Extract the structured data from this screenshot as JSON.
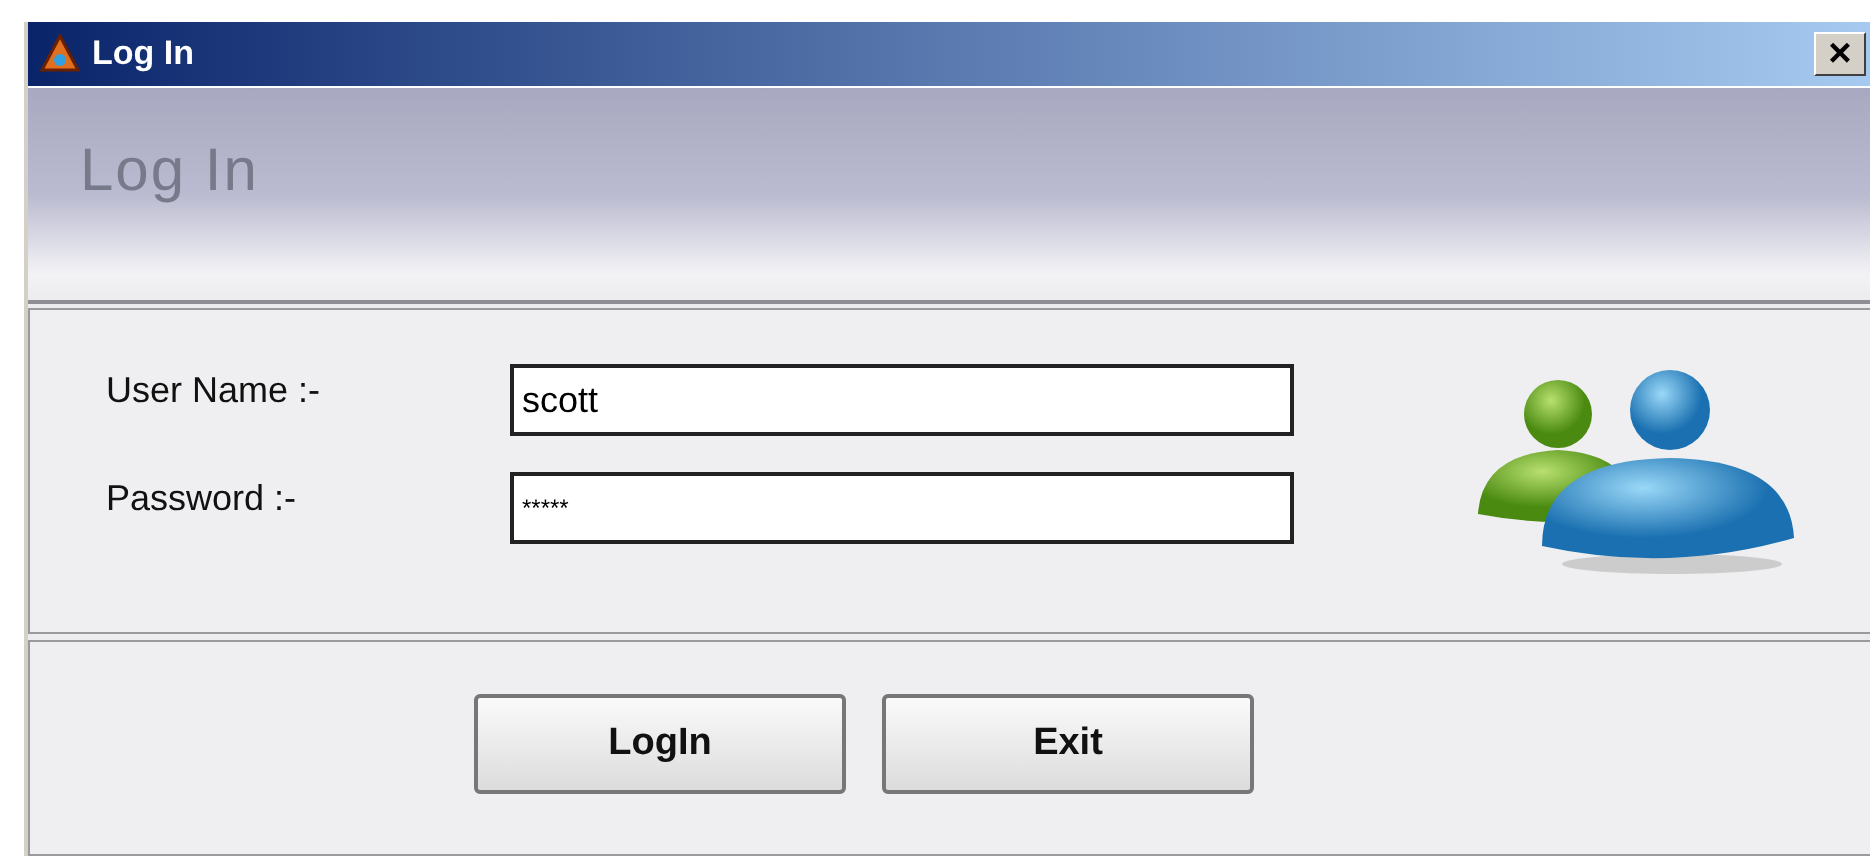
{
  "window": {
    "title": "Log In",
    "close": "×"
  },
  "header": {
    "title": "Log In"
  },
  "fields": [
    {
      "label": "User Name :-",
      "value": "scott"
    },
    {
      "label": "Password :-",
      "value": "*****"
    }
  ],
  "buttons": [
    "LogIn",
    "Exit"
  ]
}
